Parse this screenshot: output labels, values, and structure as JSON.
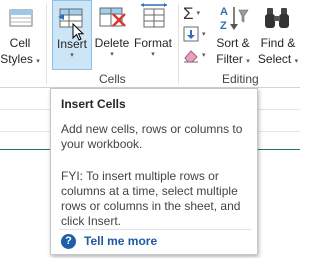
{
  "ribbon": {
    "cell_styles": {
      "label_line1": "Cell",
      "label_line2": "Styles",
      "arrow": "▾"
    },
    "insert": {
      "label": "Insert",
      "arrow": "▾"
    },
    "delete": {
      "label": "Delete",
      "arrow": "▾"
    },
    "format": {
      "label": "Format",
      "arrow": "▾"
    },
    "sort_filter": {
      "label_line1": "Sort &",
      "label_line2": "Filter",
      "arrow": "▾"
    },
    "find_select": {
      "label_line1": "Find &",
      "label_line2": "Select",
      "arrow": "▾"
    },
    "groups": {
      "cells": "Cells",
      "editing": "Editing"
    },
    "small_arrow": "▾"
  },
  "tooltip": {
    "title": "Insert Cells",
    "description": "Add new cells, rows or columns to your workbook.",
    "fyi": "FYI: To insert multiple rows or columns at a time, select multiple rows or columns in the sheet, and click Insert.",
    "help_glyph": "?",
    "tell_me_more": "Tell me more"
  },
  "colors": {
    "accent_selection": "#cde6f7",
    "link": "#1e5aa0",
    "sheet_active_line": "#1e7b45"
  }
}
